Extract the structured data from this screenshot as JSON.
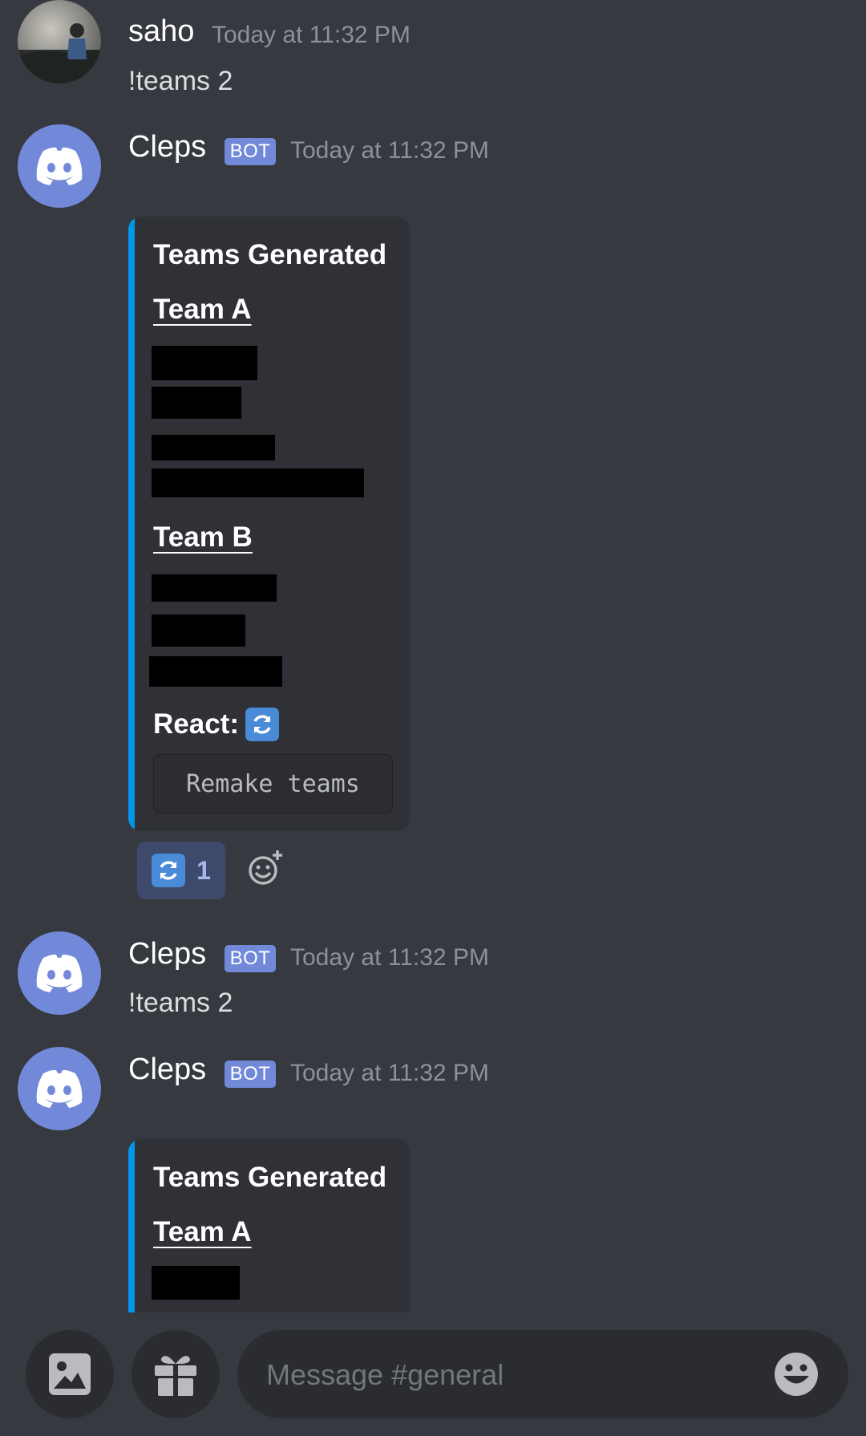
{
  "messages": [
    {
      "username": "saho",
      "timestamp": "Today at 11:32 PM",
      "text": "!teams 2",
      "avatar": "user-photo"
    },
    {
      "username": "Cleps",
      "badge": "BOT",
      "timestamp": "Today at 11:32 PM",
      "avatar": "discord-icon",
      "embed": {
        "title": "Teams Generated",
        "team_a": "Team A",
        "team_b": "Team B",
        "react_label": "React:",
        "react_emoji": "arrows-counterclockwise-icon",
        "code": "Remake teams"
      },
      "reaction": {
        "emoji": "arrows-counterclockwise-icon",
        "count": "1"
      }
    },
    {
      "username": "Cleps",
      "badge": "BOT",
      "timestamp": "Today at 11:32 PM",
      "text": "!teams 2",
      "avatar": "discord-icon"
    },
    {
      "username": "Cleps",
      "badge": "BOT",
      "timestamp": "Today at 11:32 PM",
      "avatar": "discord-icon",
      "embed": {
        "title": "Teams Generated",
        "team_a": "Team A"
      }
    }
  ],
  "input": {
    "placeholder": "Message #general"
  },
  "icons": {
    "attach": "image-icon",
    "gift": "gift-icon",
    "emoji": "emoji-icon",
    "add_reaction": "add-reaction-icon"
  },
  "colors": {
    "background": "#36393f",
    "embed_bg": "#2f3136",
    "embed_accent": "#0096e6",
    "blurple": "#7289da",
    "redaction": "#000000"
  }
}
